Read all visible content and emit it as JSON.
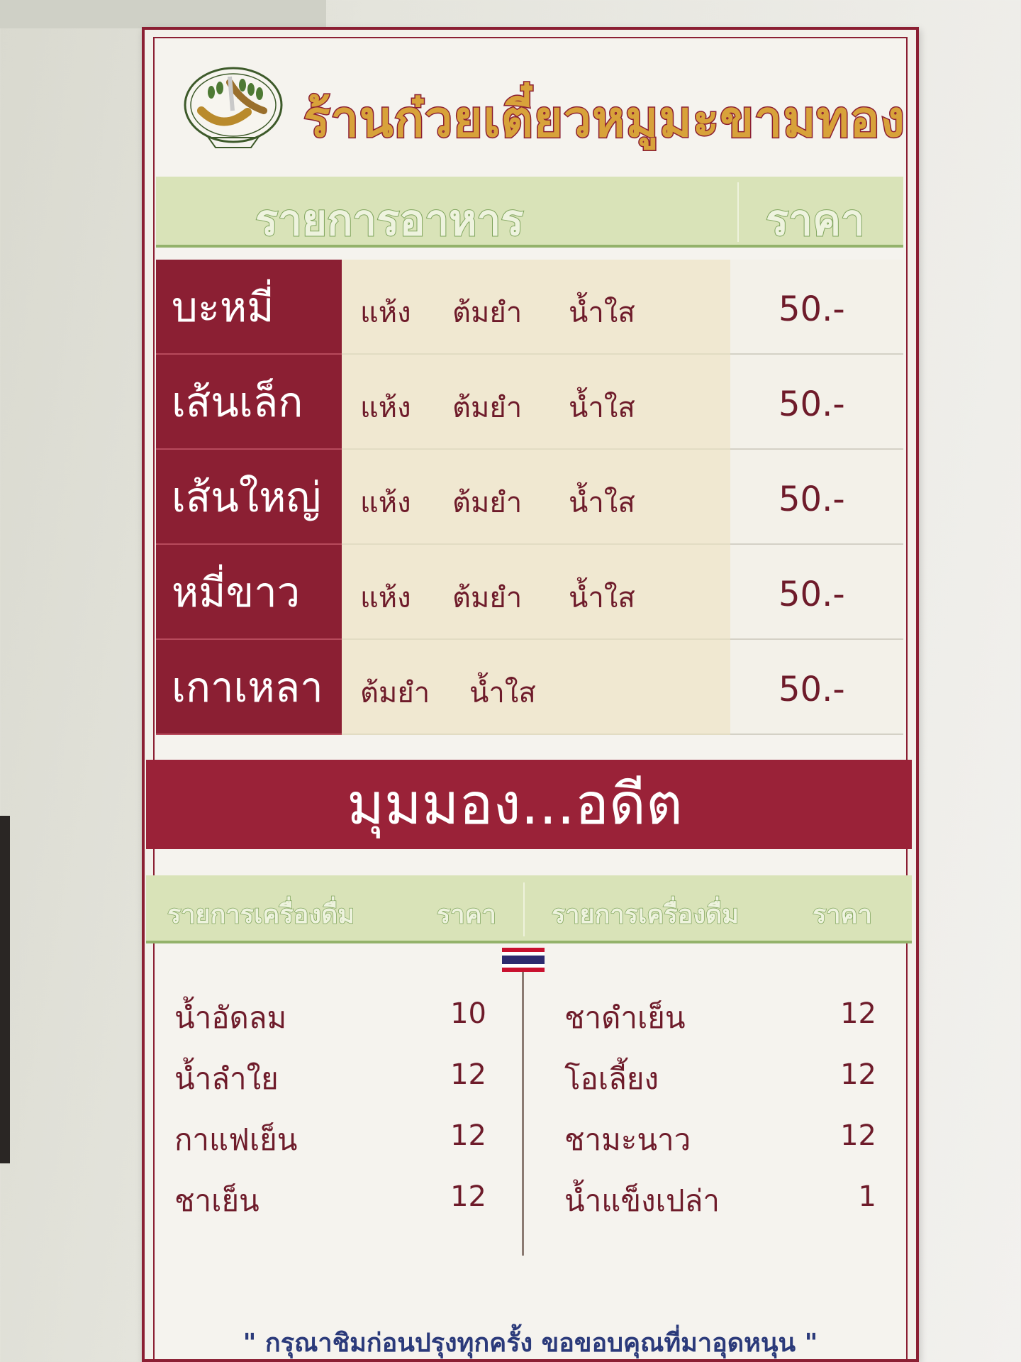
{
  "shop": {
    "title": "ร้านก๋วยเตี๋ยวหมูมะขามทอง"
  },
  "food": {
    "header_item": "รายการอาหาร",
    "header_price": "ราคา",
    "rows": [
      {
        "name": "บะหมี่",
        "options": [
          "แห้ง",
          "ต้มยำ",
          "น้ำใส"
        ],
        "price": "50.-"
      },
      {
        "name": "เส้นเล็ก",
        "options": [
          "แห้ง",
          "ต้มยำ",
          "น้ำใส"
        ],
        "price": "50.-"
      },
      {
        "name": "เส้นใหญ่",
        "options": [
          "แห้ง",
          "ต้มยำ",
          "น้ำใส"
        ],
        "price": "50.-"
      },
      {
        "name": "หมี่ขาว",
        "options": [
          "แห้ง",
          "ต้มยำ",
          "น้ำใส"
        ],
        "price": "50.-"
      },
      {
        "name": "เกาเหลา",
        "options": [
          "ต้มยำ",
          "น้ำใส"
        ],
        "price": "50.-"
      }
    ]
  },
  "slogan": "มุมมอง...อดีต",
  "drinks": {
    "header_item": "รายการเครื่องดื่ม",
    "header_price": "ราคา",
    "left": [
      {
        "name": "น้ำอัดลม",
        "price": "10"
      },
      {
        "name": "น้ำลำใย",
        "price": "12"
      },
      {
        "name": "กาแฟเย็น",
        "price": "12"
      },
      {
        "name": "ชาเย็น",
        "price": "12"
      }
    ],
    "right": [
      {
        "name": "ชาดำเย็น",
        "price": "12"
      },
      {
        "name": "โอเลี้ยง",
        "price": "12"
      },
      {
        "name": "ชามะนาว",
        "price": "12"
      },
      {
        "name": "น้ำแข็งเปล่า",
        "price": "1"
      }
    ]
  },
  "footer": "\" กรุณาชิมก่อนปรุงทุกครั้ง  ขอขอบคุณที่มาอุดหนุน \"",
  "colors": {
    "maroon": "#8b1f33",
    "green_band": "#d9e3b8",
    "cream": "#f0e8d1",
    "footer_blue": "#2b3a7a"
  }
}
